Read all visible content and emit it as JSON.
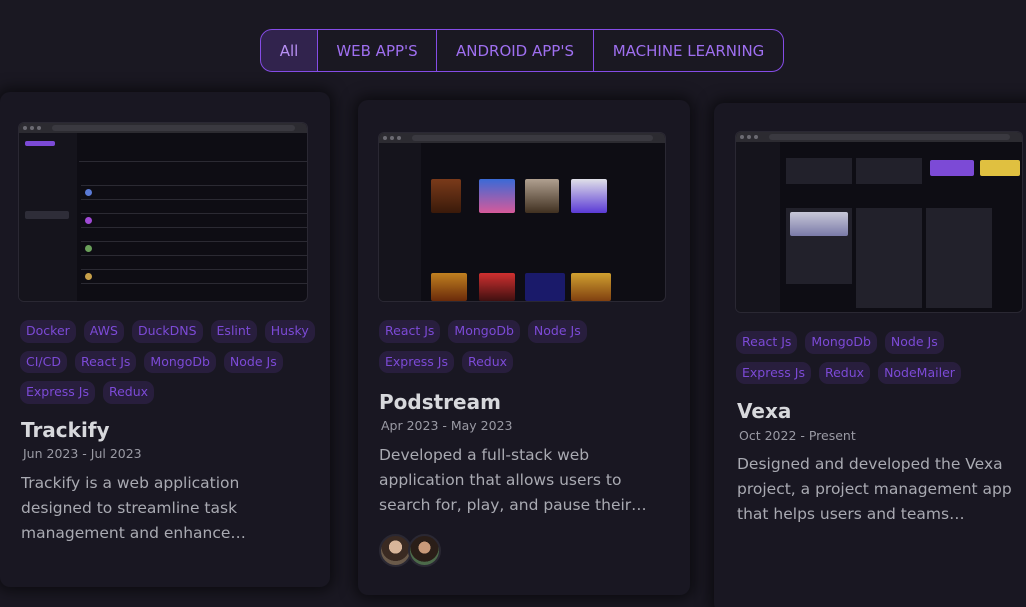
{
  "filters": {
    "all": "All",
    "web": "WEB APP'S",
    "android": "ANDROID APP'S",
    "ml": "MACHINE LEARNING"
  },
  "colors": {
    "accent": "#854ce6",
    "background": "#1a1822",
    "card": "#191722"
  },
  "projects": [
    {
      "title": "Trackify",
      "date": "Jun 2023 - Jul 2023",
      "description": "Trackify is a web application designed to streamline task management and enhance…",
      "tags": [
        "Docker",
        "AWS",
        "DuckDNS",
        "Eslint",
        "Husky",
        "CI/CD",
        "React Js",
        "MongoDb",
        "Node Js",
        "Express Js",
        "Redux"
      ]
    },
    {
      "title": "Podstream",
      "date": "Apr 2023 - May 2023",
      "description": "Developed a full-stack web application that allows users to search for, play, and pause their…",
      "tags": [
        "React Js",
        "MongoDb",
        "Node Js",
        "Express Js",
        "Redux"
      ]
    },
    {
      "title": "Vexa",
      "date": "Oct 2022 - Present",
      "description": "Designed and developed the Vexa project, a project management app that helps users and teams…",
      "tags": [
        "React Js",
        "MongoDb",
        "Node Js",
        "Express Js",
        "Redux",
        "NodeMailer"
      ]
    }
  ]
}
